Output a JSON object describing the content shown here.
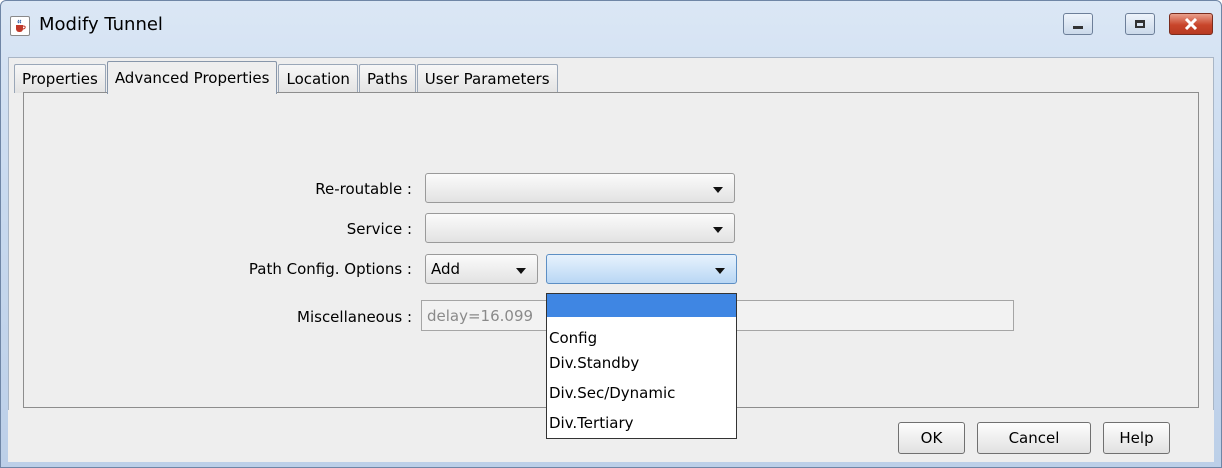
{
  "window": {
    "title": "Modify Tunnel",
    "icon": "java-cup-icon",
    "controls": [
      "minimize-icon",
      "maximize-icon",
      "close-icon"
    ]
  },
  "tabs": [
    {
      "label": "Properties",
      "active": false
    },
    {
      "label": "Advanced Properties",
      "active": true
    },
    {
      "label": "Location",
      "active": false
    },
    {
      "label": "Paths",
      "active": false
    },
    {
      "label": "User Parameters",
      "active": false
    }
  ],
  "form": {
    "rerouteable": {
      "label": "Re-routable :",
      "value": ""
    },
    "service": {
      "label": "Service :",
      "value": ""
    },
    "path_config": {
      "label": "Path Config. Options :",
      "action_value": "Add",
      "option_value": "",
      "options": [
        "",
        "Config",
        "Div.Standby",
        "Div.Sec/Dynamic",
        "Div.Tertiary"
      ]
    },
    "miscellaneous": {
      "label": "Miscellaneous :",
      "value": "delay=16.099"
    }
  },
  "buttons": {
    "ok": "OK",
    "cancel": "Cancel",
    "help": "Help"
  },
  "colors": {
    "selection": "#3f86e3",
    "close_button": "#c8452b"
  }
}
